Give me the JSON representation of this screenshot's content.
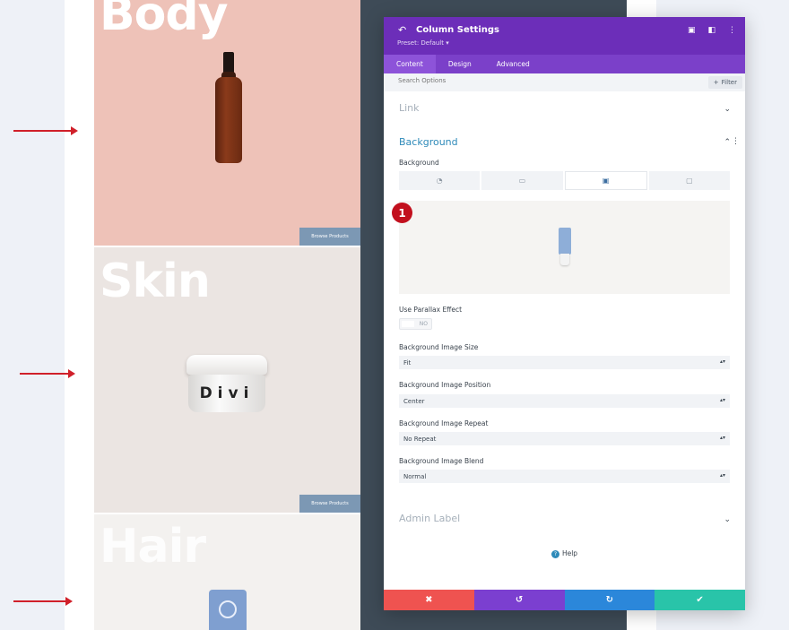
{
  "sections": {
    "body": {
      "title": "Body",
      "button": "Browse Products"
    },
    "skin": {
      "title": "Skin",
      "button": "Browse Products",
      "jar_text": "Divi"
    },
    "hair": {
      "title": "Hair"
    }
  },
  "modal": {
    "title": "Column Settings",
    "preset": "Preset: Default ▾",
    "tabs": [
      "Content",
      "Design",
      "Advanced"
    ],
    "search_placeholder": "Search Options",
    "filter_label": "Filter",
    "groups": {
      "link": "Link",
      "background": "Background",
      "admin_label": "Admin Label"
    },
    "background_label": "Background",
    "badge": "1",
    "parallax": {
      "label": "Use Parallax Effect",
      "value": "NO"
    },
    "fields": [
      {
        "label": "Background Image Size",
        "value": "Fit"
      },
      {
        "label": "Background Image Position",
        "value": "Center"
      },
      {
        "label": "Background Image Repeat",
        "value": "No Repeat"
      },
      {
        "label": "Background Image Blend",
        "value": "Normal"
      }
    ],
    "help": "Help"
  },
  "colors": {
    "header": "#6c2eb9",
    "cancel": "#ef5350",
    "undo": "#7b3fd0",
    "redo": "#2b87da",
    "save": "#29c4a9",
    "arrow": "#d0202a"
  },
  "icons": [
    "back-arrow-icon",
    "focus-icon",
    "split-view-icon",
    "more-icon",
    "color-bucket-icon",
    "gradient-icon",
    "image-icon",
    "video-icon",
    "chevron-down-icon",
    "chevron-up-icon",
    "help-icon",
    "close-icon",
    "undo-icon",
    "redo-icon",
    "check-icon",
    "right-arrow-icon"
  ]
}
